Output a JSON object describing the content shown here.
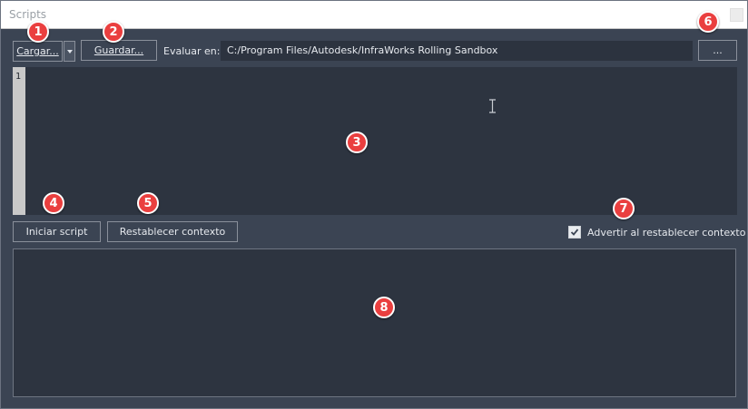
{
  "window": {
    "title": "Scripts"
  },
  "toolbar": {
    "load_label": "Cargar...",
    "save_label": "Guardar...",
    "eval_label": "Evaluar en:",
    "eval_path": "C:/Program Files/Autodesk/InfraWorks Rolling Sandbox",
    "browse_label": "..."
  },
  "editor": {
    "line_numbers": [
      "1"
    ],
    "content": ""
  },
  "actions": {
    "start_label": "Iniciar script",
    "reset_label": "Restablecer contexto",
    "warn_label": "Advertir al restablecer contexto",
    "warn_checked": true
  },
  "output": {
    "content": ""
  },
  "markers": [
    "1",
    "2",
    "3",
    "4",
    "5",
    "6",
    "7",
    "8"
  ],
  "colors": {
    "background": "#3b4453",
    "editor_background": "#2d3440",
    "marker": "#ea3f3f"
  }
}
